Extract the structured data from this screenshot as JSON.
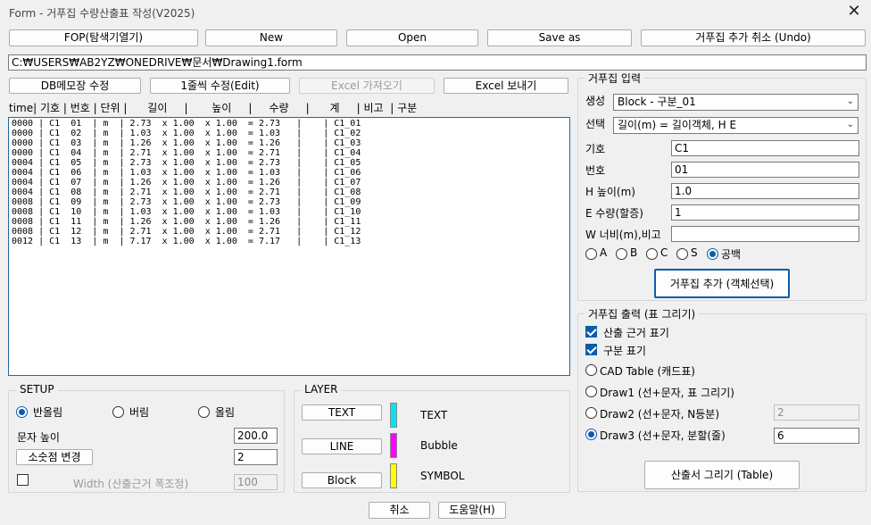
{
  "window": {
    "title": "Form - 거푸집 수량산출표 작성(V2025)",
    "close": "✕"
  },
  "toolbar": {
    "fop": "FOP(탐색기열기)",
    "new": "New",
    "open": "Open",
    "save_as": "Save as",
    "undo": "거푸집 추가 취소 (Undo)"
  },
  "path": "C:₩USERS₩AB2YZ₩ONEDRIVE₩문서₩Drawing1.form",
  "actions": {
    "db_memo": "DB메모장 수정",
    "edit_line": "1줄씩 수정(Edit)",
    "excel_import": "Excel 가져오기",
    "excel_export": "Excel 보내기"
  },
  "list": {
    "header": "time| 기호 | 번호 | 단위 |      길이     |       높이     |     수량     |      계     | 비고  | 구분",
    "rows": [
      "0000 | C1  01  | m  | 2.73  x 1.00  x 1.00  = 2.73   |    | C1_01",
      "0000 | C1  02  | m  | 1.03  x 1.00  x 1.00  = 1.03   |    | C1_02",
      "0000 | C1  03  | m  | 1.26  x 1.00  x 1.00  = 1.26   |    | C1_03",
      "0000 | C1  04  | m  | 2.71  x 1.00  x 1.00  = 2.71   |    | C1_04",
      "0004 | C1  05  | m  | 2.73  x 1.00  x 1.00  = 2.73   |    | C1_05",
      "0004 | C1  06  | m  | 1.03  x 1.00  x 1.00  = 1.03   |    | C1_06",
      "0004 | C1  07  | m  | 1.26  x 1.00  x 1.00  = 1.26   |    | C1_07",
      "0004 | C1  08  | m  | 2.71  x 1.00  x 1.00  = 2.71   |    | C1_08",
      "0008 | C1  09  | m  | 2.73  x 1.00  x 1.00  = 2.73   |    | C1_09",
      "0008 | C1  10  | m  | 1.03  x 1.00  x 1.00  = 1.03   |    | C1_10",
      "0008 | C1  11  | m  | 1.26  x 1.00  x 1.00  = 1.26   |    | C1_11",
      "0008 | C1  12  | m  | 2.71  x 1.00  x 1.00  = 2.71   |    | C1_12",
      "0012 | C1  13  | m  | 7.17  x 1.00  x 1.00  = 7.17   |    | C1_13"
    ]
  },
  "input_panel": {
    "title": "거푸집 입력",
    "create_label": "생성",
    "create_value": "Block - 구분_01",
    "select_label": "선택",
    "select_value": "길이(m) = 길이객체, H E",
    "symbol_label": "기호",
    "symbol_value": "C1",
    "number_label": "번호",
    "number_value": "01",
    "height_label": "H 높이(m)",
    "height_value": "1.0",
    "qty_label": "E 수량(할증)",
    "qty_value": "1",
    "width_label": "W 너비(m),비고",
    "width_value": "",
    "radios": [
      "A",
      "B",
      "C",
      "S",
      "공백"
    ],
    "radio_selected": "공백",
    "add_button": "거푸집 추가 (객체선택)"
  },
  "output_panel": {
    "title": "거푸집 출력 (표 그리기)",
    "chk_basis": "산출 근거 표기",
    "chk_category": "구분 표기",
    "opt_cad": "CAD Table (캐드표)",
    "opt_draw1": "Draw1 (선+문자, 표 그리기)",
    "opt_draw2": "Draw2 (선+문자, N등분)",
    "draw2_value": "2",
    "opt_draw3": "Draw3 (선+문자, 분할(줄)",
    "draw3_value": "6",
    "selected": "Draw3",
    "draw_button": "산출서 그리기 (Table)"
  },
  "setup": {
    "title": "SETUP",
    "round_half": "반올림",
    "round_down": "버림",
    "round_up": "올림",
    "round_selected": "반올림",
    "text_height_label": "문자 높이",
    "text_height_value": "200.0",
    "decimal_button": "소숫점 변경",
    "decimal_value": "2",
    "width_label": "Width (산출근거 폭조정)",
    "width_value": "100"
  },
  "layer": {
    "title": "LAYER",
    "items": [
      {
        "button": "TEXT",
        "name": "TEXT",
        "color": "#00e5ee"
      },
      {
        "button": "LINE",
        "name": "Bubble",
        "color": "#ff00ff"
      },
      {
        "button": "Block",
        "name": "SYMBOL",
        "color": "#ffff00"
      }
    ]
  },
  "footer": {
    "cancel": "취소",
    "help": "도움말(H)"
  }
}
